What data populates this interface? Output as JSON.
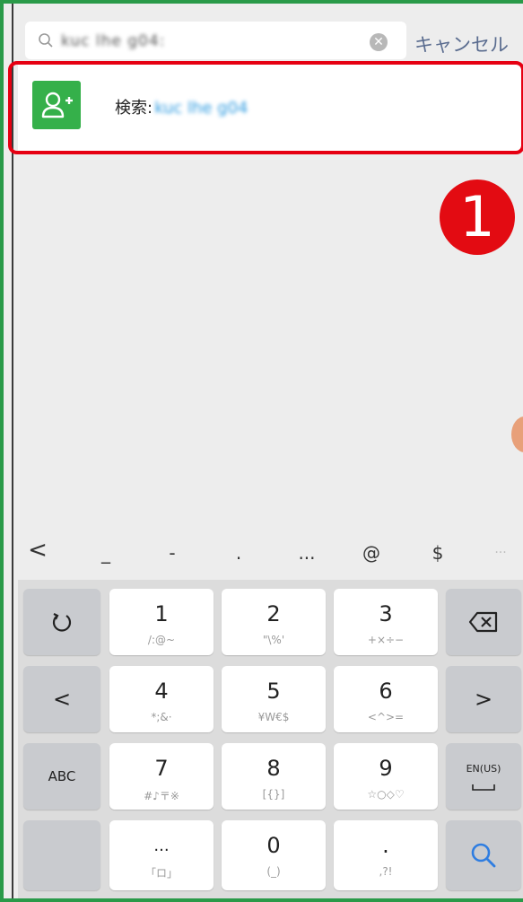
{
  "search": {
    "value": "kuc lhe g04:",
    "cancel_label": "キャンセル"
  },
  "result": {
    "label": "検索:",
    "query": "kuc lhe g04"
  },
  "badge": "1",
  "symbol_bar": [
    "<",
    "_",
    "-",
    ".",
    "...",
    "@",
    "$",
    "···"
  ],
  "keys": {
    "k1": {
      "main": "1",
      "sub": "/:@~"
    },
    "k2": {
      "main": "2",
      "sub": "\"\\%'"
    },
    "k3": {
      "main": "3",
      "sub": "+×÷−"
    },
    "k4": {
      "main": "4",
      "sub": "*;&·"
    },
    "k5": {
      "main": "5",
      "sub": "¥W€$"
    },
    "k6": {
      "main": "6",
      "sub": "<^>="
    },
    "k7": {
      "main": "7",
      "sub": "#♪〒※"
    },
    "k8": {
      "main": "8",
      "sub": "[{}]"
    },
    "k9": {
      "main": "9",
      "sub": "☆○◇♡"
    },
    "k0": {
      "main": "0",
      "sub": "(_)"
    },
    "kellipsis": {
      "main": "...",
      "sub": "「ロ」"
    },
    "kdot": {
      "main": ".",
      "sub": ",?!"
    },
    "abc": "ABC",
    "en": "EN(US)"
  },
  "colors": {
    "accent_green": "#35b04a",
    "highlight_red": "#e60012",
    "link_blue": "#5a6c8f",
    "search_key_blue": "#2e7de1"
  }
}
